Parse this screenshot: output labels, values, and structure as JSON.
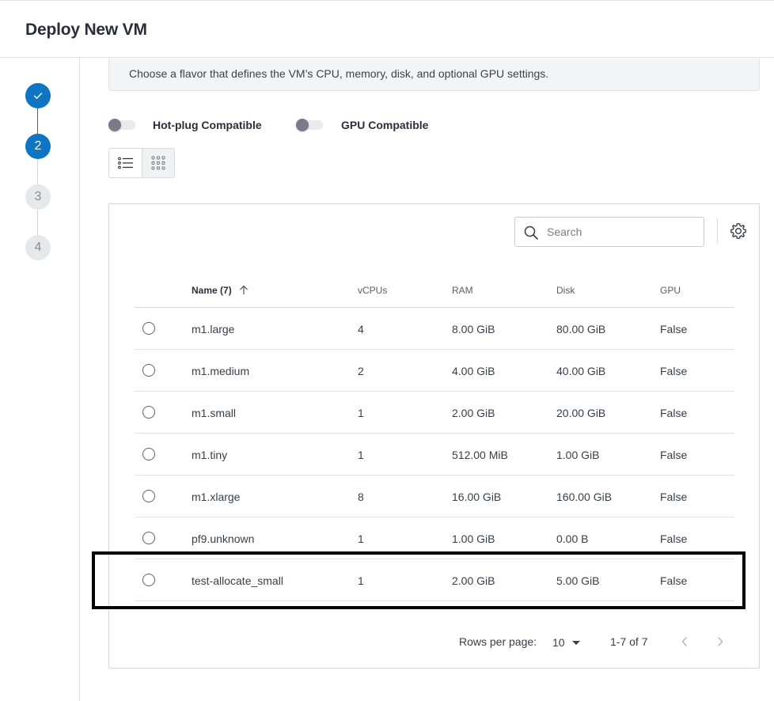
{
  "header": {
    "title": "Deploy New VM"
  },
  "stepper": {
    "steps": [
      {
        "status": "done",
        "label": ""
      },
      {
        "status": "current",
        "label": "2"
      },
      {
        "status": "pending",
        "label": "3"
      },
      {
        "status": "pending",
        "label": "4"
      }
    ]
  },
  "info": {
    "text": "Choose a flavor that defines the VM’s CPU, memory, disk, and optional GPU settings."
  },
  "filters": {
    "hotplug_label": "Hot-plug Compatible",
    "hotplug_on": false,
    "gpu_label": "GPU Compatible",
    "gpu_on": false
  },
  "view": {
    "active": "list"
  },
  "table": {
    "search_placeholder": "Search",
    "columns": {
      "name": "Name (7)",
      "vcpus": "vCPUs",
      "ram": "RAM",
      "disk": "Disk",
      "gpu": "GPU"
    },
    "rows": [
      {
        "name": "m1.large",
        "vcpus": "4",
        "ram": "8.00 GiB",
        "disk": "80.00 GiB",
        "gpu": "False"
      },
      {
        "name": "m1.medium",
        "vcpus": "2",
        "ram": "4.00 GiB",
        "disk": "40.00 GiB",
        "gpu": "False"
      },
      {
        "name": "m1.small",
        "vcpus": "1",
        "ram": "2.00 GiB",
        "disk": "20.00 GiB",
        "gpu": "False"
      },
      {
        "name": "m1.tiny",
        "vcpus": "1",
        "ram": "512.00 MiB",
        "disk": "1.00 GiB",
        "gpu": "False"
      },
      {
        "name": "m1.xlarge",
        "vcpus": "8",
        "ram": "16.00 GiB",
        "disk": "160.00 GiB",
        "gpu": "False"
      },
      {
        "name": "pf9.unknown",
        "vcpus": "1",
        "ram": "1.00 GiB",
        "disk": "0.00 B",
        "gpu": "False"
      },
      {
        "name": "test-allocate_small",
        "vcpus": "1",
        "ram": "2.00 GiB",
        "disk": "5.00 GiB",
        "gpu": "False"
      }
    ],
    "footer": {
      "rows_per_page_label": "Rows per page:",
      "rows_per_page_value": "10",
      "range_text": "1-7 of 7"
    }
  },
  "colors": {
    "accent": "#0d75c2",
    "highlight_border": "#000000"
  }
}
